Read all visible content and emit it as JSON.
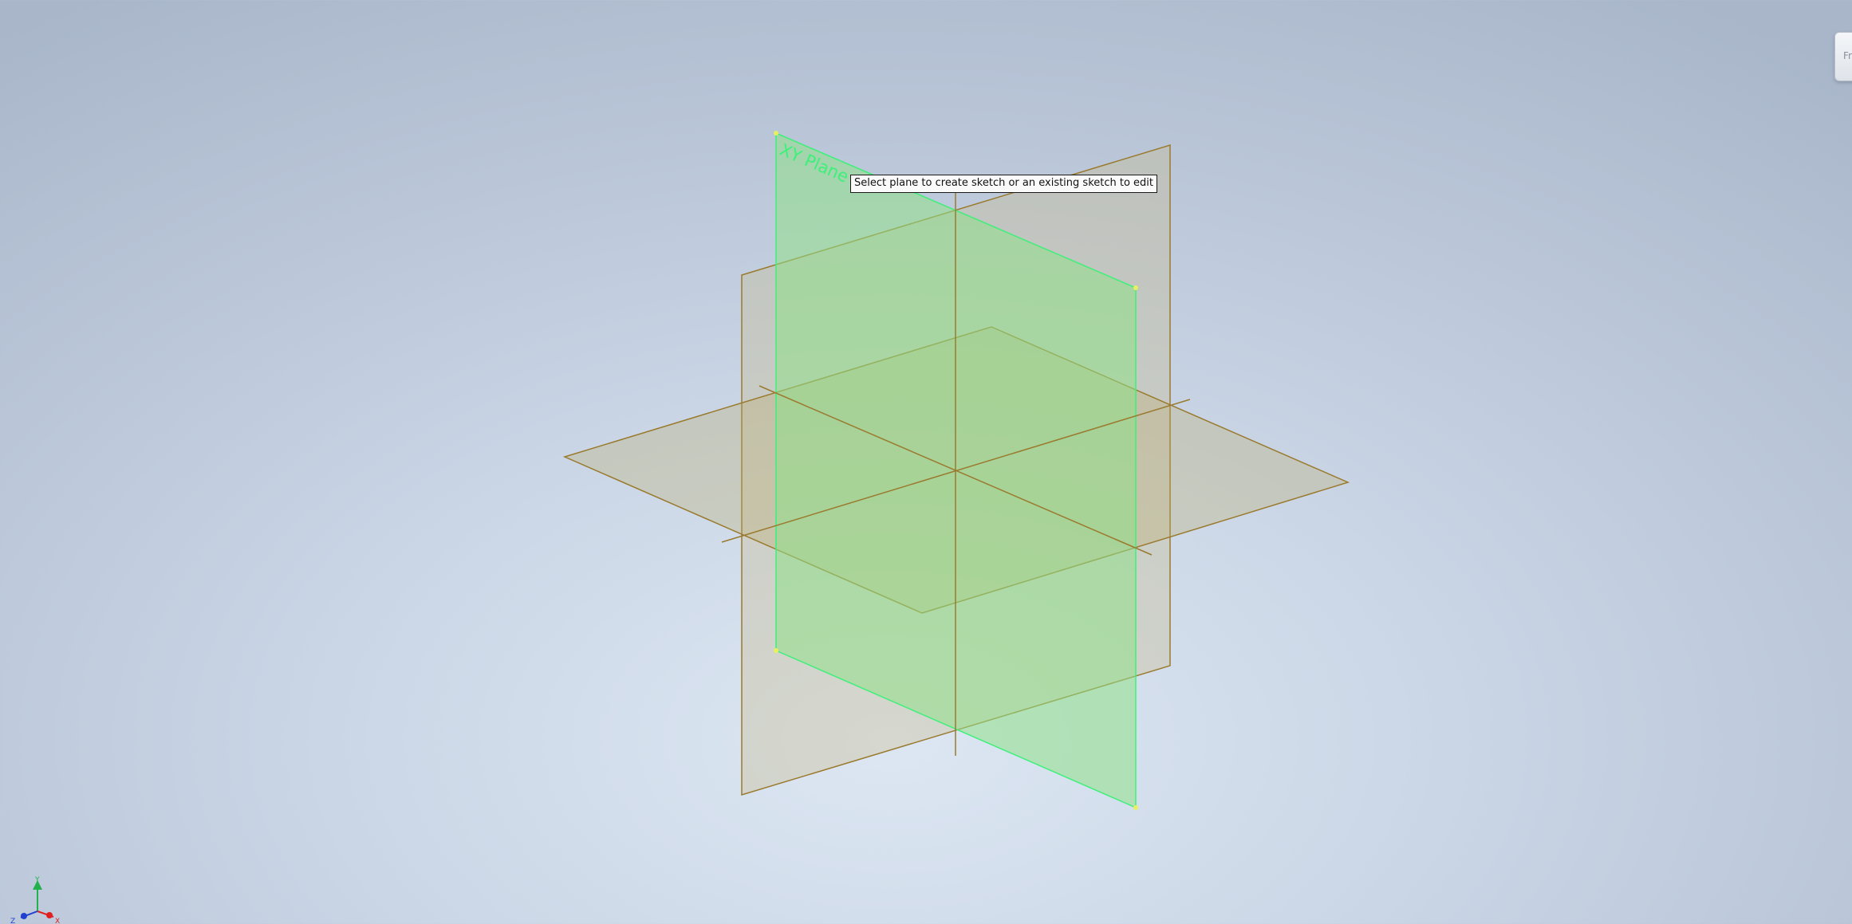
{
  "viewport": {
    "selected_plane_label": "XY Plane",
    "tooltip": "Select plane to create sketch or an existing sketch to edit",
    "viewcube_label": "Fr"
  },
  "colors": {
    "background_center": "#dde7f3",
    "background_edge": "#a9b6ca",
    "plane_outline": "#9a7a2e",
    "plane_fill": "#c8b882",
    "selected_plane_outline": "#3ef07a",
    "selected_plane_fill": "#8fe089",
    "axis_y": "#22b14c",
    "axis_x": "#e02020",
    "axis_z": "#2040d0"
  },
  "triad": {
    "x_label": "X",
    "y_label": "Y",
    "z_label": "Z"
  }
}
